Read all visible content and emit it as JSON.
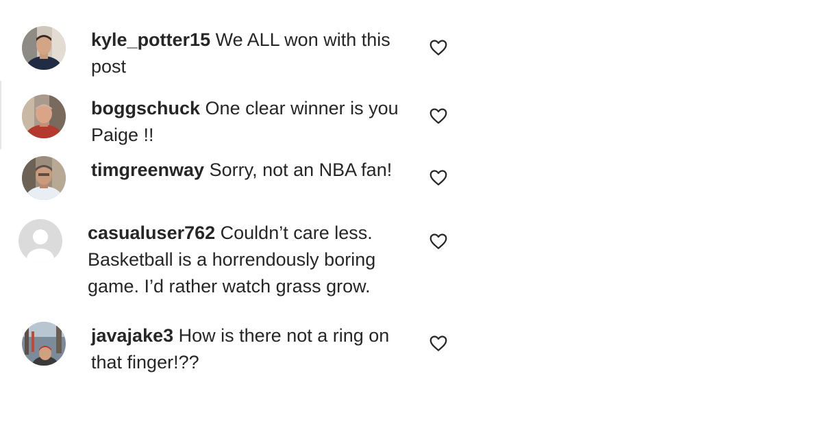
{
  "comments": [
    {
      "username": "kyle_potter15",
      "text": "We ALL won with this\npost",
      "avatar": "photo-avatar",
      "like_icon": "heart-icon"
    },
    {
      "username": "boggschuck",
      "text": "One clear winner is you\nPaige !!",
      "avatar": "photo-avatar",
      "like_icon": "heart-icon"
    },
    {
      "username": "timgreenway",
      "text": "Sorry, not an NBA fan!",
      "avatar": "photo-avatar",
      "like_icon": "heart-icon"
    },
    {
      "username": "casualuser762",
      "text": "Couldn’t care less.\nBasketball is a horrendously boring\ngame. I’d rather watch grass grow.",
      "avatar": "default-avatar",
      "like_icon": "heart-icon"
    },
    {
      "username": "javajake3",
      "text": "How is there not a ring on\nthat finger!??",
      "avatar": "photo-avatar",
      "like_icon": "heart-icon"
    }
  ],
  "colors": {
    "text": "#262626",
    "heart_outline": "#262626",
    "default_avatar_bg": "#dbdbdb"
  }
}
